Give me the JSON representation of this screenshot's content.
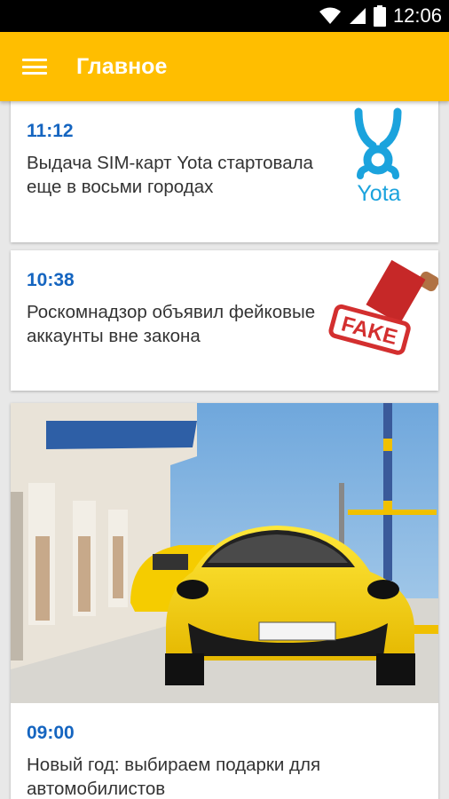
{
  "status_bar": {
    "time": "12:06",
    "icons": [
      "wifi-icon",
      "signal-icon",
      "battery-icon"
    ]
  },
  "app_bar": {
    "title": "Главное",
    "menu_icon": "hamburger-menu-icon",
    "background": "#ffbe00"
  },
  "colors": {
    "accent_time": "#1565c0",
    "headline": "#333333",
    "card_bg": "#ffffff",
    "page_bg": "#e8e8e8"
  },
  "feed": {
    "items": [
      {
        "time": "11:12",
        "title": "Выдача SIM-карт Yota стартовала еще в восьми городах",
        "thumbnail": "yota-logo",
        "logo_text": "Yota"
      },
      {
        "time": "10:38",
        "title": "Роскомнадзор объявил фейковые аккаунты вне закона",
        "thumbnail": "fake-stamp",
        "stamp_text": "FAKE"
      },
      {
        "time": "09:00",
        "title": "Новый год: выбираем подарки для автомобилистов",
        "thumbnail": "yellow-sports-car-photo"
      }
    ]
  }
}
